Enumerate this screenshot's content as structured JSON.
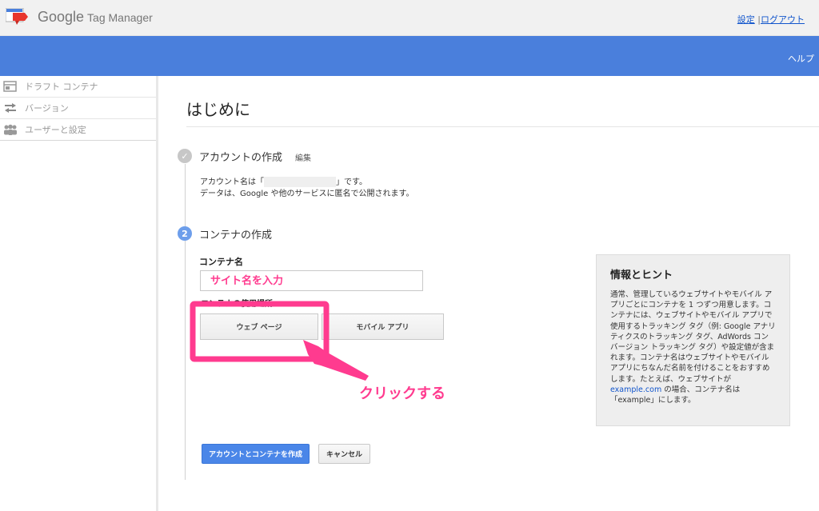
{
  "header": {
    "brand_google": "Google",
    "brand_product": "Tag Manager",
    "settings_link": "設定",
    "separator": "|",
    "logout_link": "ログアウト",
    "help_link": "ヘルプ"
  },
  "sidebar": {
    "items": [
      {
        "label": "ドラフト コンテナ",
        "icon": "draft-container-icon"
      },
      {
        "label": "バージョン",
        "icon": "versions-icon"
      },
      {
        "label": "ユーザーと設定",
        "icon": "users-icon"
      }
    ]
  },
  "main": {
    "title": "はじめに",
    "step1": {
      "number": "✓",
      "title": "アカウントの作成",
      "edit_label": "編集",
      "desc_line1_prefix": "アカウント名は「",
      "desc_line1_suffix": "」です。",
      "desc_line2": "データは、Google や他のサービスに匿名で公開されます。"
    },
    "step2": {
      "number": "2",
      "title": "コンテナの作成",
      "container_name_label": "コンテナ名",
      "container_name_placeholder": "サイト名を入力",
      "usage_label": "コンテナの使用場所",
      "web_page_button": "ウェブ ページ",
      "mobile_app_button": "モバイル アプリ"
    },
    "annotation_text": "クリックする",
    "create_button": "アカウントとコンテナを作成",
    "cancel_button": "キャンセル"
  },
  "tips": {
    "title": "情報とヒント",
    "body_before_link": "通常、管理しているウェブサイトやモバイル アプリごとにコンテナを 1 つずつ用意します。コンテナには、ウェブサイトやモバイル アプリで使用するトラッキング タグ（例: Google アナリティクスのトラッキング タグ、AdWords コンバージョン トラッキング タグ）や設定値が含まれます。コンテナ名はウェブサイトやモバイル アプリにちなんだ名前を付けることをおすすめします。たとえば、ウェブサイトが ",
    "link": "example.com",
    "body_after_link": " の場合、コンテナ名は「example」にします。"
  },
  "colors": {
    "header_blue": "#4a7fdc",
    "annotation_pink": "#ff3b8f",
    "primary_button": "#4a86e8"
  }
}
